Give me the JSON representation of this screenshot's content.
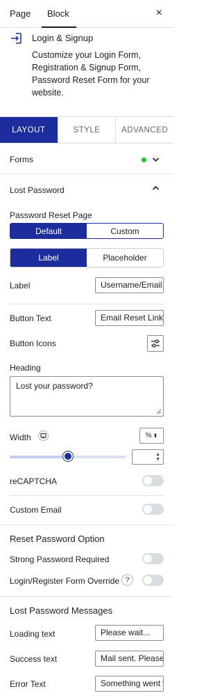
{
  "topbar": {
    "tabs": [
      {
        "label": "Page"
      },
      {
        "label": "Block"
      }
    ],
    "close_glyph": "×"
  },
  "block_card": {
    "icon": "login-arrow-icon",
    "title": "Login & Signup",
    "description": "Customize your Login Form, Registration & Signup Form, Password Reset Form for your website."
  },
  "panel_tabs": [
    {
      "label": "LAYOUT"
    },
    {
      "label": "STYLE"
    },
    {
      "label": "ADVANCED"
    }
  ],
  "forms": {
    "label": "Forms",
    "status_color": "#2fbf2f"
  },
  "lost_password": {
    "title": "Lost Password",
    "reset_page_label": "Password Reset Page",
    "reset_page_options": [
      "Default",
      "Custom"
    ],
    "mode_options": [
      "Label",
      "Placeholder"
    ],
    "label_field": {
      "label": "Label",
      "value": "Username/Email"
    },
    "button_text": {
      "label": "Button Text",
      "value": "Email Reset Link"
    },
    "button_icons_label": "Button Icons",
    "heading": {
      "label": "Heading",
      "value": "Lost your password?"
    },
    "width": {
      "label": "Width",
      "unit": "%",
      "slider_fraction": 0.5
    },
    "recaptcha_label": "reCAPTCHA",
    "custom_email_label": "Custom Email"
  },
  "reset_option": {
    "title": "Reset Password Option",
    "strong_label": "Strong Password Required",
    "override_label": "Login/Register Form Override",
    "help_glyph": "?"
  },
  "messages": {
    "title": "Lost Password Messages",
    "loading": {
      "label": "Loading text",
      "value": "Please wait..."
    },
    "success": {
      "label": "Success text",
      "value": "Mail sent. Please check your mailbox"
    },
    "error": {
      "label": "Error Text",
      "value": "Something went wrong"
    }
  },
  "colors": {
    "accent": "#1e2d9e",
    "toggle_off": "#d7dde0"
  }
}
